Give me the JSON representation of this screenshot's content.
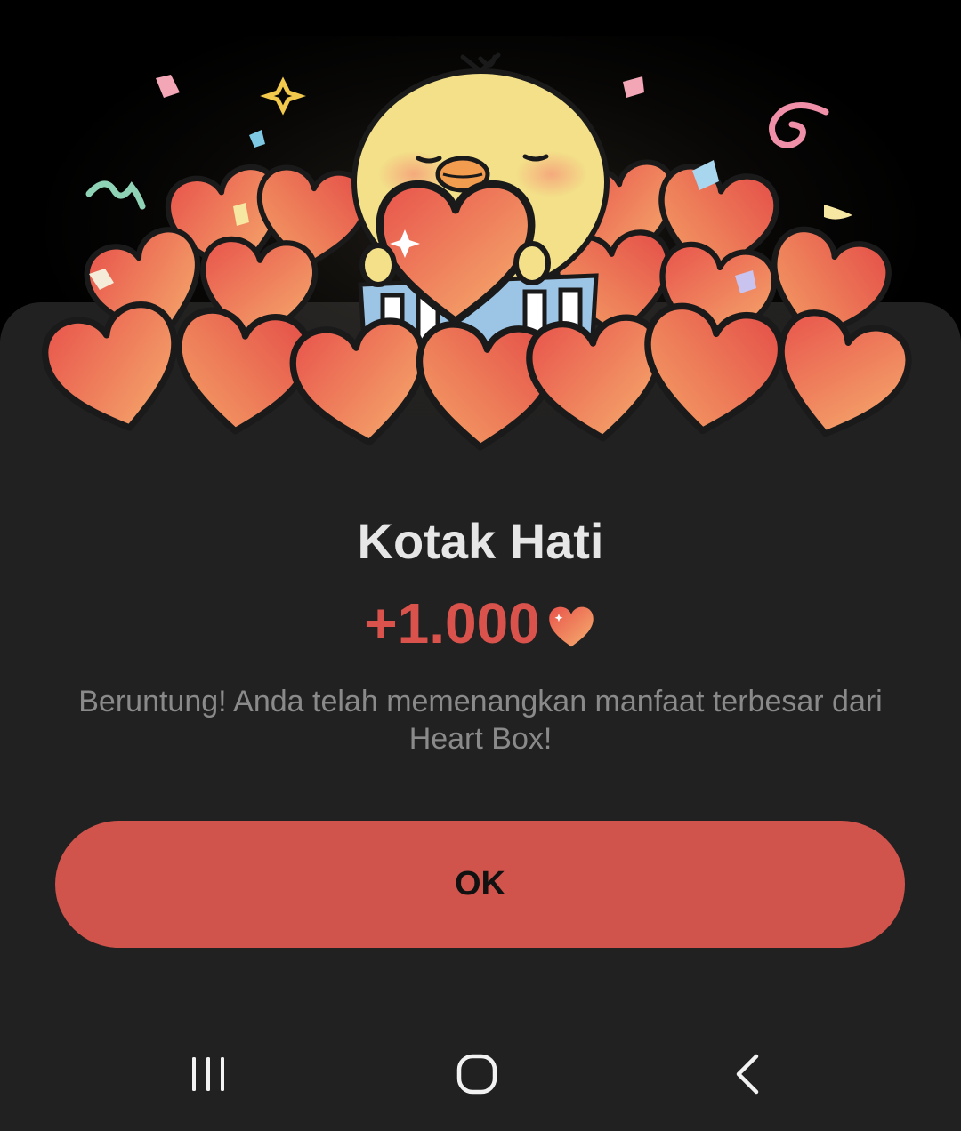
{
  "dialog": {
    "title": "Kotak Hati",
    "reward_amount": "+1.000",
    "reward_icon": "heart-icon",
    "message": "Beruntung! Anda telah memenangkan manfaat terbesar dari Heart Box!",
    "ok_label": "OK"
  },
  "illustration": {
    "subject": "chick-with-hearts",
    "icons": [
      "confetti",
      "sparkle",
      "heart-icon"
    ]
  },
  "navigation_bar": {
    "buttons": [
      "recent-apps-icon",
      "home-icon",
      "back-icon"
    ]
  },
  "colors": {
    "accent": "#d0534c",
    "sheet_background": "#212121",
    "screen_background": "#000000",
    "title_text": "#e6e6e6",
    "message_text": "#8a8a8a",
    "heart_light": "#f5a467",
    "heart_dark": "#e8534b",
    "chick_yellow": "#f3e089"
  }
}
